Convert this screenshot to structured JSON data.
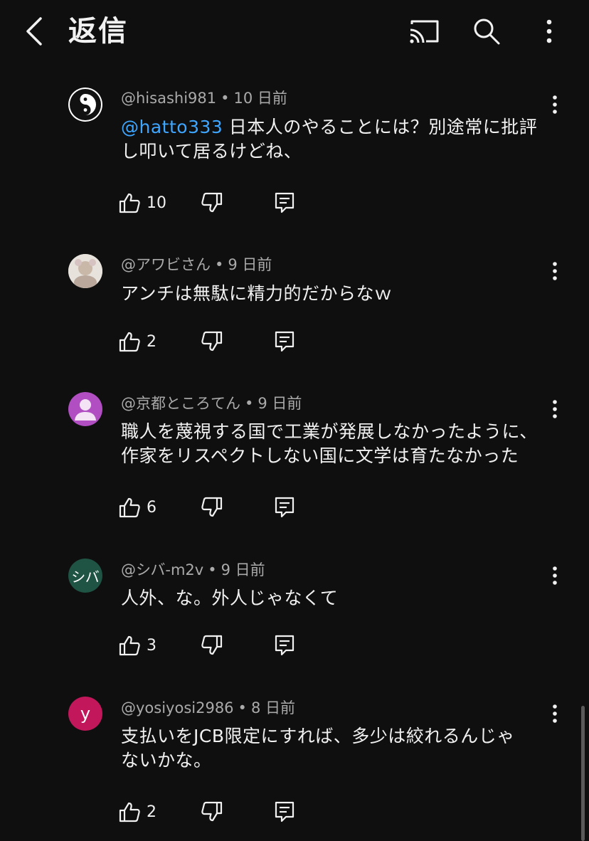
{
  "header": {
    "title": "返信",
    "icons": [
      "back-icon",
      "cast-icon",
      "search-icon",
      "more-vert-icon"
    ]
  },
  "comments": [
    {
      "author": "@hisashi981",
      "time": "10 日前",
      "mention": "@hatto333",
      "text_line1": " 日本人のやることには？別途常に批評",
      "text_line2": "し叩いて居るけどね、",
      "likes": "10",
      "avatar": {
        "type": "logo",
        "bg": "#ffffff"
      }
    },
    {
      "author": "@アワビさん",
      "time": "9 日前",
      "text_line1": "アンチは無駄に精力的だからなｗ",
      "text_line2": "",
      "likes": "2",
      "avatar": {
        "type": "photo",
        "bg": "#d9d4d0"
      }
    },
    {
      "author": "@京都ところてん",
      "time": "9 日前",
      "text_line1": "職人を蔑視する国で工業が発展しなかったように、",
      "text_line2": "作家をリスペクトしない国に文学は育たなかった",
      "likes": "6",
      "avatar": {
        "type": "default",
        "bg": "#b04ec2"
      }
    },
    {
      "author": "@シバ-m2v",
      "time": "9 日前",
      "text_line1": "人外、な。外人じゃなくて",
      "text_line2": "",
      "likes": "3",
      "avatar": {
        "type": "letter",
        "letter": "シバ",
        "bg": "#1f5445"
      }
    },
    {
      "author": "@yosiyosi2986",
      "time": "8 日前",
      "text_line1": "支払いをJCB限定にすれば、多少は絞れるんじゃ",
      "text_line2": "ないかな。",
      "likes": "2",
      "avatar": {
        "type": "letter",
        "letter": "y",
        "bg": "#c2185b"
      }
    }
  ],
  "meta_separator": "•",
  "colors": {
    "background": "#0f0f0f",
    "text": "#f1f1f1",
    "secondary_text": "#aaaaaa",
    "mention": "#3ea6ff"
  }
}
